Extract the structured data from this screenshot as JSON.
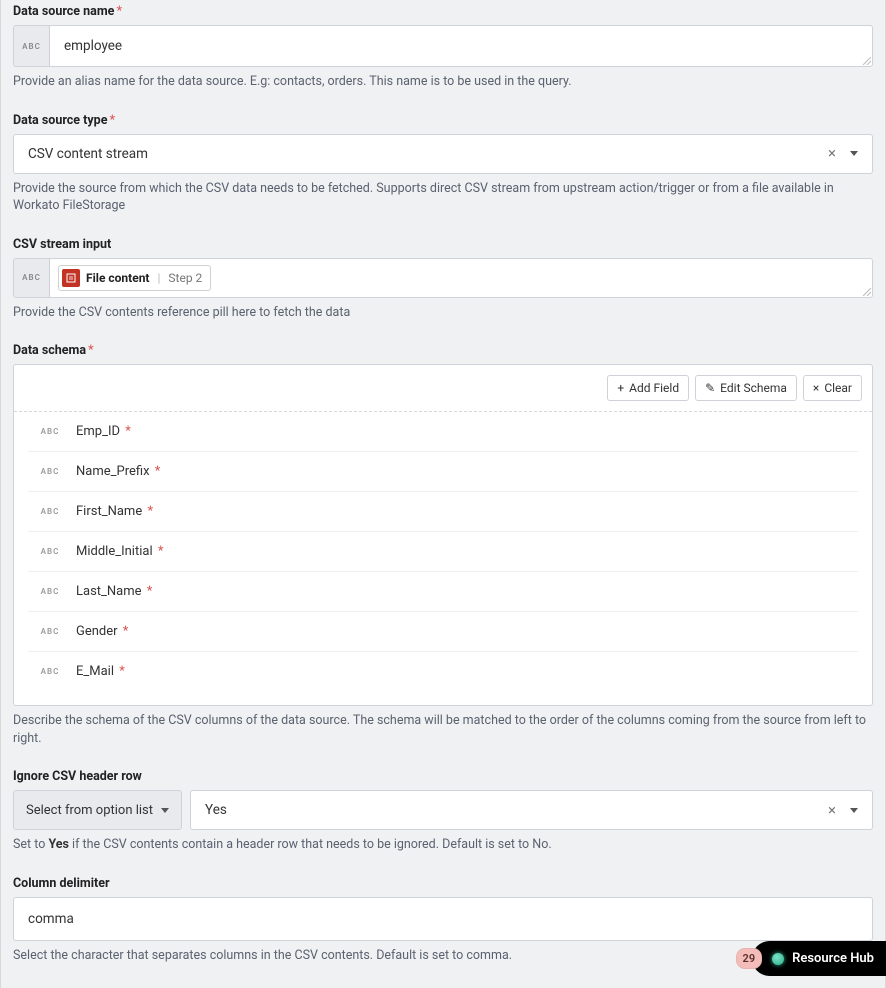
{
  "dataSourceName": {
    "label": "Data source name",
    "value": "employee",
    "help": "Provide an alias name for the data source. E.g: contacts, orders. This name is to be used in the query."
  },
  "dataSourceType": {
    "label": "Data source type",
    "value": "CSV content stream",
    "help": "Provide the source from which the CSV data needs to be fetched. Supports direct CSV stream from upstream action/trigger or from a file available in Workato FileStorage"
  },
  "csvStreamInput": {
    "label": "CSV stream input",
    "pill": {
      "main": "File content",
      "step": "Step 2"
    },
    "help": "Provide the CSV contents reference pill here to fetch the data"
  },
  "dataSchema": {
    "label": "Data schema",
    "buttons": {
      "add": "Add Field",
      "edit": "Edit Schema",
      "clear": "Clear"
    },
    "fields": [
      {
        "name": "Emp_ID"
      },
      {
        "name": "Name_Prefix"
      },
      {
        "name": "First_Name"
      },
      {
        "name": "Middle_Initial"
      },
      {
        "name": "Last_Name"
      },
      {
        "name": "Gender"
      },
      {
        "name": "E_Mail"
      }
    ],
    "help": "Describe the schema of the CSV columns of the data source. The schema will be matched to the order of the columns coming from the source from left to right."
  },
  "ignoreHeader": {
    "label": "Ignore CSV header row",
    "optionListLabel": "Select from option list",
    "value": "Yes",
    "helpPrefix": "Set to ",
    "helpBold": "Yes",
    "helpSuffix": " if the CSV contents contain a header row that needs to be ignored. Default is set to No."
  },
  "columnDelimiter": {
    "label": "Column delimiter",
    "value": "comma",
    "help": "Select the character that separates columns in the CSV contents. Default is set to comma."
  },
  "resourceHub": {
    "badge": "29",
    "label": "Resource Hub"
  },
  "abc": "ABC"
}
